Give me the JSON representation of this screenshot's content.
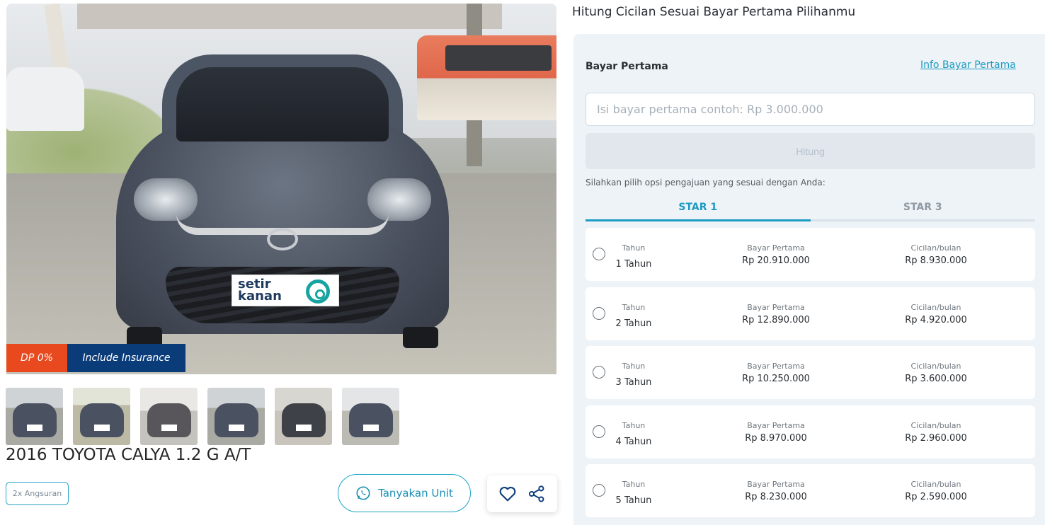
{
  "listing": {
    "badges": {
      "dp": "DP 0%",
      "insurance": "Include Insurance"
    },
    "plate_brand": "setir kanan",
    "plate_line1": "setir",
    "plate_line2": "kanan",
    "title": "2016 TOYOTA CALYA 1.2 G A/T",
    "tag": "2x Angsuran",
    "ask_button": "Tanyakan Unit",
    "icons": [
      "whatsapp-icon",
      "heart-icon",
      "share-icon"
    ],
    "thumbnail_count": 6
  },
  "calculator": {
    "title": "Hitung Cicilan Sesuai Bayar Pertama Pilihanmu",
    "bp_label": "Bayar Pertama",
    "info_link": "Info Bayar Pertama",
    "input_placeholder": "Isi bayar pertama contoh: Rp 3.000.000",
    "input_value": "",
    "hitung_button": "Hitung",
    "choose_text": "Silahkan pilih opsi pengajuan yang sesuai dengan Anda:",
    "tabs": [
      {
        "label": "STAR 1",
        "active": true
      },
      {
        "label": "STAR 3",
        "active": false
      }
    ],
    "column_labels": {
      "tenor": "Tahun",
      "down_payment": "Bayar Pertama",
      "monthly": "Cicilan/bulan"
    },
    "options": [
      {
        "tenor": "1 Tahun",
        "down_payment": "Rp 20.910.000",
        "monthly": "Rp 8.930.000"
      },
      {
        "tenor": "2 Tahun",
        "down_payment": "Rp 12.890.000",
        "monthly": "Rp 4.920.000"
      },
      {
        "tenor": "3 Tahun",
        "down_payment": "Rp 10.250.000",
        "monthly": "Rp 3.600.000"
      },
      {
        "tenor": "4 Tahun",
        "down_payment": "Rp 8.970.000",
        "monthly": "Rp 2.960.000"
      },
      {
        "tenor": "5 Tahun",
        "down_payment": "Rp 8.230.000",
        "monthly": "Rp 2.590.000"
      }
    ]
  },
  "colors": {
    "accent": "#1b9ac2",
    "dp_badge": "#e8491f",
    "insurance_badge": "#0b3c7a",
    "panel_bg": "#eef3f7"
  }
}
